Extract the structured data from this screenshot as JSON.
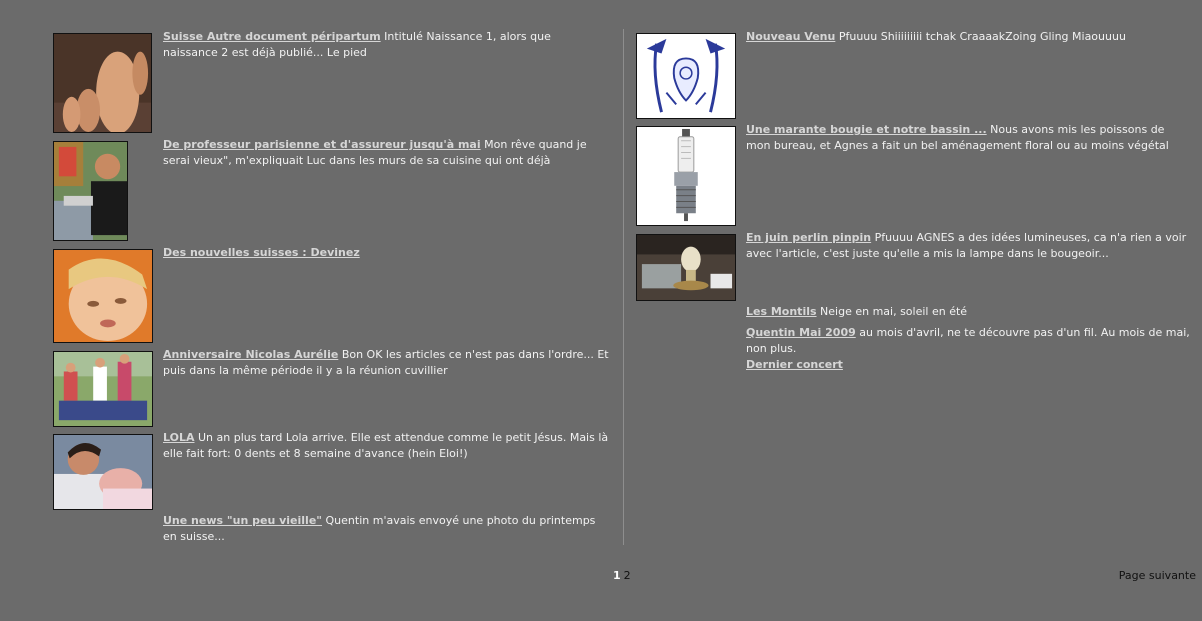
{
  "left_posts": [
    {
      "title": "Suisse Autre document péripartum",
      "excerpt": "Intitulé Naissance 1, alors que naissance 2 est déjà publié... Le pied",
      "thumb": "foot-photo"
    },
    {
      "title": "De professeur parisienne et d'assureur jusqu'à mai",
      "excerpt": "Mon rêve quand je serai vieux\", m'expliquait Luc dans les murs de sa cuisine qui ont déjà",
      "thumb": "man-portrait-photo"
    },
    {
      "title": "Des nouvelles suisses : Devinez",
      "excerpt": "",
      "thumb": "child-face-photo"
    },
    {
      "title": "Anniversaire Nicolas Aurélie",
      "excerpt": "Bon OK les articles ce n'est pas dans l'ordre... Et puis dans la même période il y a la réunion cuvillier",
      "thumb": "garden-party-photo"
    },
    {
      "title": "LOLA",
      "excerpt": "Un an plus tard Lola arrive. Elle est attendue comme le petit Jésus. Mais là elle fait fort: 0 dents et 8 semaine d'avance (hein Eloi!)",
      "thumb": "newborn-photo"
    },
    {
      "title": "Une news \"un peu vieille\"",
      "excerpt": "Quentin m'avais envoyé une photo du printemps en suisse...",
      "thumb": ""
    }
  ],
  "right_posts": [
    {
      "title": "Nouveau Venu",
      "excerpt": "Pfuuuu Shiiiiiiiii tchak CraaaakZoing Gling Miaouuuu",
      "thumb": "drawing-illustration"
    },
    {
      "title": "Une marante bougie et notre bassin ...",
      "excerpt": "Nous avons mis les poissons de mon bureau, et Agnes a fait un bel aménagement floral ou au moins végétal",
      "thumb": "spark-plug-photo"
    },
    {
      "title": "En juin perlin pinpin",
      "excerpt": "Pfuuuu AGNES a des idées lumineuses, ca n'a rien a voir avec l'article, c'est juste qu'elle a mis la lampe dans le bougeoir...",
      "thumb": "lamp-photo"
    },
    {
      "title": "Les Montils",
      "excerpt": "Neige en mai, soleil en été",
      "thumb": ""
    },
    {
      "title": "Quentin Mai 2009",
      "excerpt": "au mois d'avril, ne te découvre pas d'un fil. Au mois de mai, non plus.",
      "thumb": ""
    },
    {
      "title": "Dernier concert",
      "excerpt": "",
      "thumb": ""
    }
  ],
  "pager": {
    "current": "1",
    "other": "2",
    "next_label": "Page suivante"
  }
}
